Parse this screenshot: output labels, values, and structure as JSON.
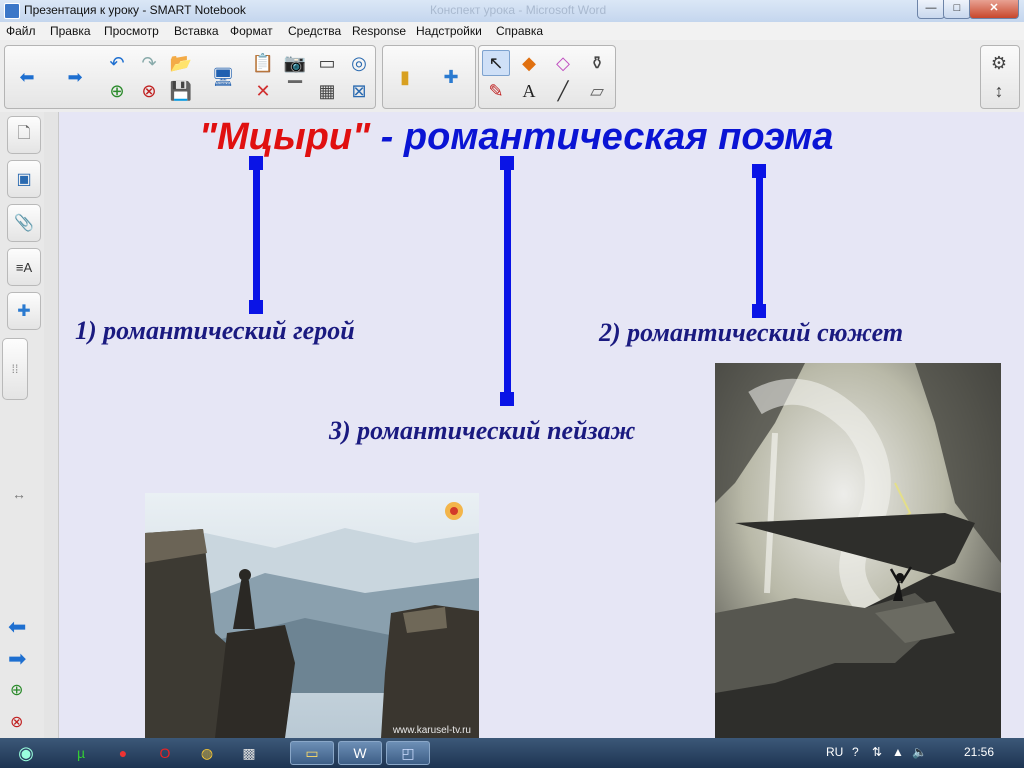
{
  "window": {
    "title": "Презентация к уроку - SMART Notebook",
    "background_title": "Конспект урока - Microsoft Word",
    "controls": {
      "minimize": "—",
      "maximize": "□",
      "close": "✕"
    }
  },
  "menu": [
    "Файл",
    "Правка",
    "Просмотр",
    "Вставка",
    "Формат",
    "Средства",
    "Response",
    "Надстройки",
    "Справка"
  ],
  "toolbar": {
    "nav": {
      "back": "back-arrow-icon",
      "forward": "forward-arrow-icon"
    },
    "edit": {
      "undo": "undo-icon",
      "redo": "redo-icon",
      "open": "open-folder-icon",
      "add_page": "add-page-icon",
      "delete_page": "delete-page-icon",
      "save": "save-icon"
    },
    "view": {
      "display": "display-icon",
      "paste": "paste-icon",
      "screen_capture": "screen-capture-icon",
      "screen_shade": "screen-shade-icon",
      "delete": "delete-icon",
      "table": "table-icon",
      "document_camera": "document-camera-icon",
      "cancel": "cancel-icon"
    },
    "addons": {
      "capture": "capture-icon",
      "gallery": "puzzle-icon"
    },
    "tools": {
      "select": "select-pointer-icon",
      "shapes": "shapes-icon",
      "eraser_pen": "highlighter-icon",
      "fill": "fill-icon",
      "pens": "pens-icon",
      "text": "text-A-icon",
      "line": "line-icon",
      "eraser": "eraser-icon"
    },
    "settings": {
      "gear": "gear-icon",
      "move_toolbar": "move-toolbar-icon"
    }
  },
  "sidetabs": [
    "page-sorter-icon",
    "gallery-icon",
    "attachments-icon",
    "properties-icon",
    "addons-icon"
  ],
  "slide": {
    "title_red": "\"Мцыри\"",
    "title_dash": " - ",
    "title_blue": "романтическая поэма",
    "concepts": {
      "hero": "1) романтический герой",
      "plot": "2) романтический сюжет",
      "landscape": "3) романтический пейзаж"
    },
    "image_left_credit": "www.karusel-tv.ru"
  },
  "taskbar": {
    "apps": [
      "start-orb-icon",
      "utorrent-icon",
      "yandex-icon",
      "opera-icon",
      "chrome-icon",
      "paint-icon",
      "explorer-icon",
      "word-icon",
      "smart-notebook-icon"
    ],
    "lang": "RU",
    "time": "21:56"
  },
  "colors": {
    "title_red": "#e01010",
    "title_blue": "#0a14d4",
    "connector_blue": "#0a14e6",
    "concept_text": "#1a1a80",
    "canvas": "#e6e6f5"
  }
}
